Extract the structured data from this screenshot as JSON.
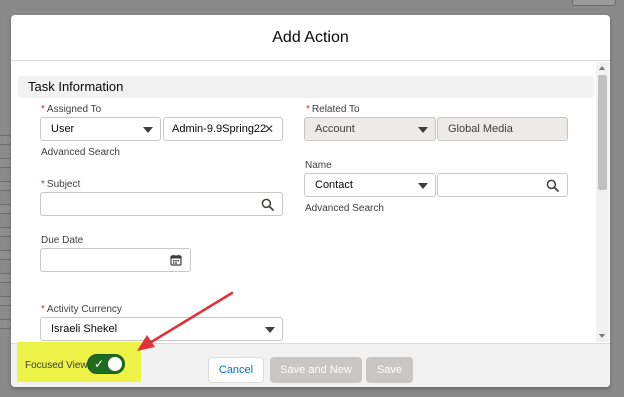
{
  "modal": {
    "title": "Add Action"
  },
  "section": {
    "title": "Task Information"
  },
  "assigned_to": {
    "label": "Assigned To",
    "type_value": "User",
    "user_value": "Admin-9.9Spring22",
    "advanced_search": "Advanced Search"
  },
  "related_to": {
    "label": "Related To",
    "type_value": "Account",
    "record_value": "Global Media"
  },
  "name": {
    "label": "Name",
    "type_value": "Contact",
    "search_value": "",
    "advanced_search": "Advanced Search"
  },
  "subject": {
    "label": "Subject",
    "value": ""
  },
  "due_date": {
    "label": "Due Date",
    "value": ""
  },
  "activity_currency": {
    "label": "Activity Currency",
    "value": "Israeli Shekel"
  },
  "footer": {
    "focused_view_label": "Focused View",
    "focused_view_on": true,
    "cancel_label": "Cancel",
    "save_and_new_label": "Save and New",
    "save_label": "Save"
  },
  "colors": {
    "highlight": "#ecf246",
    "annotation_arrow": "#e0323a",
    "toggle_on": "#1f6b1f",
    "link": "#0070d2",
    "required": "#c23934"
  },
  "icons": {
    "clear": "close-icon",
    "search": "search-icon",
    "date": "calendar-icon",
    "select": "chevron-down-icon"
  }
}
